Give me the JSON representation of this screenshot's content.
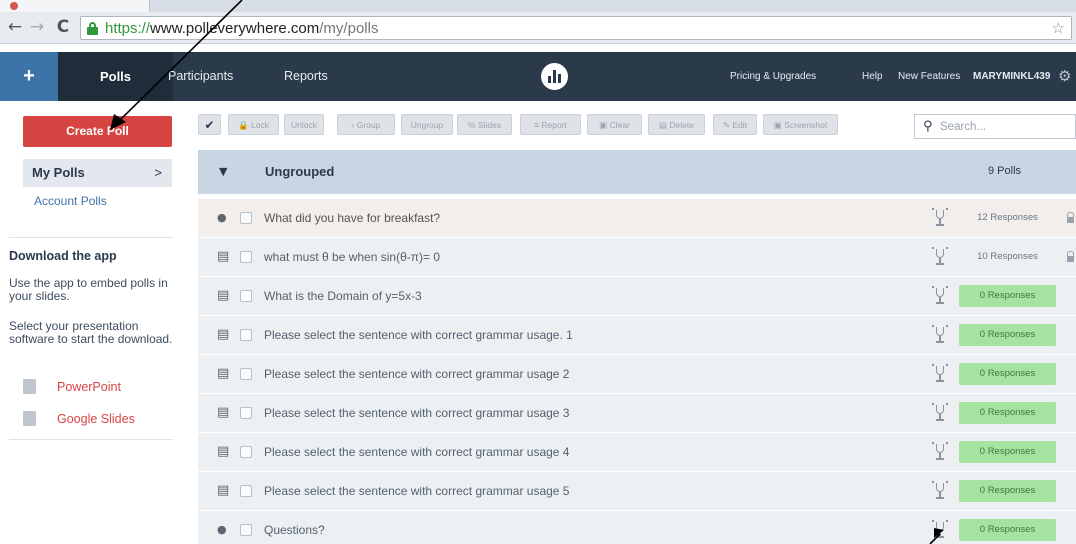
{
  "browser": {
    "url_scheme": "https://",
    "url_host": "www.polleverywhere.com",
    "url_path": "/my/polls",
    "back_icon": "back-arrow-icon",
    "forward_icon": "forward-arrow-icon",
    "reload_icon": "reload-icon"
  },
  "header": {
    "plus": "+",
    "nav": {
      "polls": "Polls",
      "participants": "Participants",
      "reports": "Reports"
    },
    "right": {
      "pricing": "Pricing & Upgrades",
      "help": "Help",
      "new_features": "New Features",
      "user": "MARYMINKL439"
    },
    "colors": {
      "bar": "#2b3a4a",
      "plus_tab": "#3d74a8",
      "active_tab": "#1f2c3a"
    }
  },
  "sidebar": {
    "create_poll": "Create Poll",
    "my_polls": "My Polls",
    "my_polls_chevron": ">",
    "account_polls": "Account Polls",
    "download_title": "Download the app",
    "download_text_1": "Use the app to embed polls in your slides.",
    "download_text_2": "Select your presentation software to start the download.",
    "apps": [
      {
        "label": "PowerPoint",
        "icon": "powerpoint-icon"
      },
      {
        "label": "Google Slides",
        "icon": "google-slides-icon"
      }
    ],
    "accent": "#d64541"
  },
  "toolbar": {
    "check": "✔",
    "buttons": [
      "Lock",
      "Unlock",
      "Group",
      "Ungroup",
      "Slides",
      "Report",
      "Clear",
      "Delete",
      "Edit",
      "Screenshot"
    ],
    "search_placeholder": "Search..."
  },
  "group": {
    "name": "Ungrouped",
    "count": "9 Polls"
  },
  "polls": [
    {
      "type_icon": "speech-bubble-icon",
      "title": "What did you have for breakfast?",
      "responses": "12 Responses",
      "zero": false,
      "locked": true
    },
    {
      "type_icon": "multiple-choice-icon",
      "title": "what must θ be when sin(θ-π)= 0",
      "responses": "10 Responses",
      "zero": false,
      "locked": true
    },
    {
      "type_icon": "multiple-choice-icon",
      "title": "What is the Domain of y=5x-3",
      "responses": "0 Responses",
      "zero": true,
      "locked": false
    },
    {
      "type_icon": "multiple-choice-icon",
      "title": "Please select the sentence with correct grammar usage. 1",
      "responses": "0 Responses",
      "zero": true,
      "locked": false
    },
    {
      "type_icon": "multiple-choice-icon",
      "title": "Please select the sentence with correct grammar usage 2",
      "responses": "0 Responses",
      "zero": true,
      "locked": false
    },
    {
      "type_icon": "multiple-choice-icon",
      "title": "Please select the sentence with correct grammar usage 3",
      "responses": "0 Responses",
      "zero": true,
      "locked": false
    },
    {
      "type_icon": "multiple-choice-icon",
      "title": "Please select the sentence with correct grammar usage 4",
      "responses": "0 Responses",
      "zero": true,
      "locked": false
    },
    {
      "type_icon": "multiple-choice-icon",
      "title": "Please select the sentence with correct grammar usage 5",
      "responses": "0 Responses",
      "zero": true,
      "locked": false
    },
    {
      "type_icon": "speech-bubble-icon",
      "title": "Questions?",
      "responses": "0 Responses",
      "zero": true,
      "locked": false
    }
  ]
}
